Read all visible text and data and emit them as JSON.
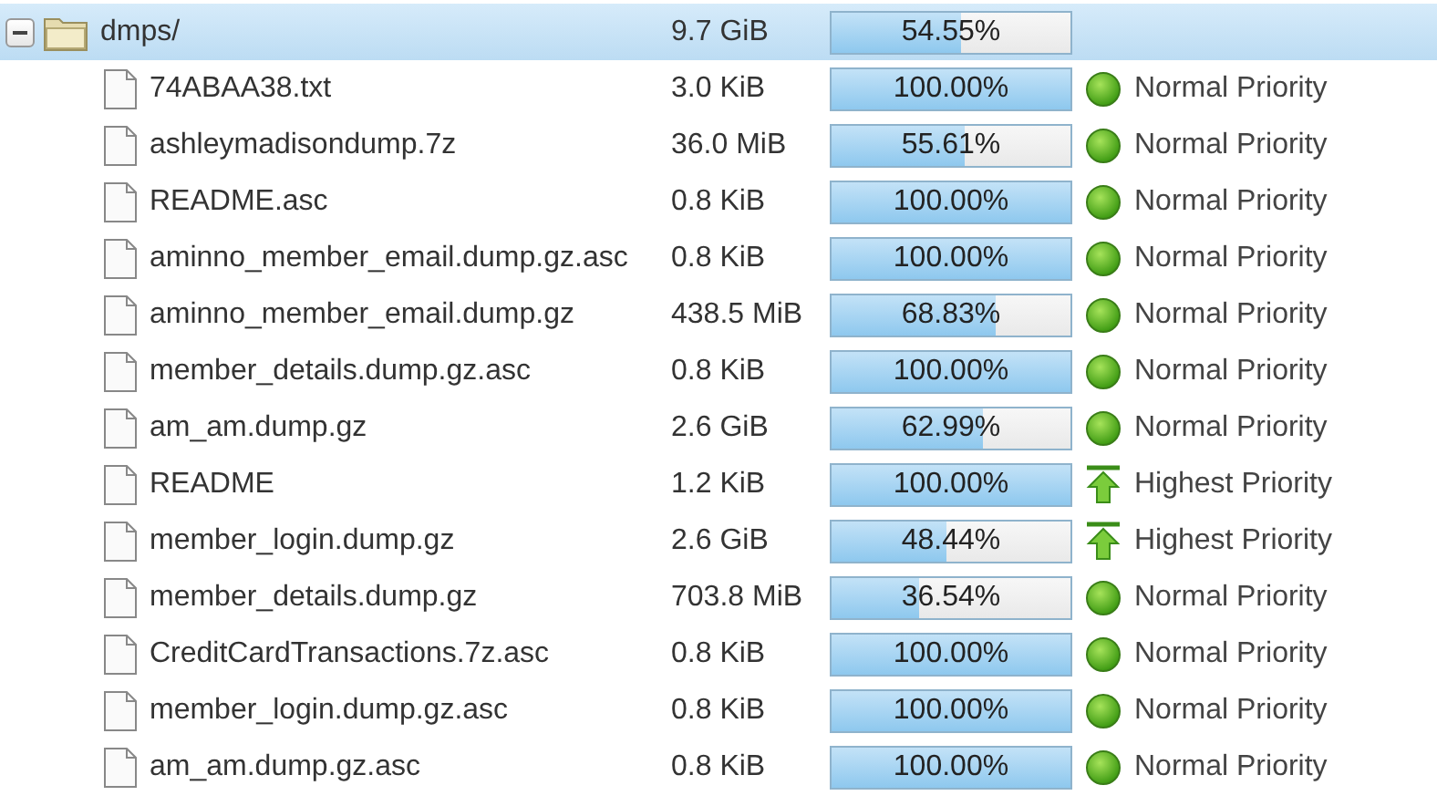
{
  "files": [
    {
      "name": "dmps/",
      "kind": "folder",
      "expanded": true,
      "selected": true,
      "size": "9.7 GiB",
      "level": 0.5455,
      "progress": "54.55%",
      "children": [
        {
          "name": "74ABAA38.txt",
          "kind": "file",
          "size": "3.0 KiB",
          "level": 1,
          "progress": "100.00%",
          "priority": {
            "kind": "normal",
            "label": "Normal Priority"
          }
        },
        {
          "name": "ashleymadisondump.7z",
          "kind": "file",
          "size": "36.0 MiB",
          "level": 0.5561,
          "progress": "55.61%",
          "priority": {
            "kind": "normal",
            "label": "Normal Priority"
          }
        },
        {
          "name": "README.asc",
          "kind": "file",
          "size": "0.8 KiB",
          "level": 1,
          "progress": "100.00%",
          "priority": {
            "kind": "normal",
            "label": "Normal Priority"
          }
        },
        {
          "name": "aminno_member_email.dump.gz.asc",
          "kind": "file",
          "size": "0.8 KiB",
          "level": 1,
          "progress": "100.00%",
          "priority": {
            "kind": "normal",
            "label": "Normal Priority"
          }
        },
        {
          "name": "aminno_member_email.dump.gz",
          "kind": "file",
          "size": "438.5 MiB",
          "level": 0.6883,
          "progress": "68.83%",
          "priority": {
            "kind": "normal",
            "label": "Normal Priority"
          }
        },
        {
          "name": "member_details.dump.gz.asc",
          "kind": "file",
          "size": "0.8 KiB",
          "level": 1,
          "progress": "100.00%",
          "priority": {
            "kind": "normal",
            "label": "Normal Priority"
          }
        },
        {
          "name": "am_am.dump.gz",
          "kind": "file",
          "size": "2.6 GiB",
          "level": 0.6299,
          "progress": "62.99%",
          "priority": {
            "kind": "normal",
            "label": "Normal Priority"
          }
        },
        {
          "name": "README",
          "kind": "file",
          "size": "1.2 KiB",
          "level": 1,
          "progress": "100.00%",
          "priority": {
            "kind": "highest",
            "label": "Highest Priority"
          }
        },
        {
          "name": "member_login.dump.gz",
          "kind": "file",
          "size": "2.6 GiB",
          "level": 0.4844,
          "progress": "48.44%",
          "priority": {
            "kind": "highest",
            "label": "Highest Priority"
          }
        },
        {
          "name": "member_details.dump.gz",
          "kind": "file",
          "size": "703.8 MiB",
          "level": 0.3654,
          "progress": "36.54%",
          "priority": {
            "kind": "normal",
            "label": "Normal Priority"
          }
        },
        {
          "name": "CreditCardTransactions.7z.asc",
          "kind": "file",
          "size": "0.8 KiB",
          "level": 1,
          "progress": "100.00%",
          "priority": {
            "kind": "normal",
            "label": "Normal Priority"
          }
        },
        {
          "name": "member_login.dump.gz.asc",
          "kind": "file",
          "size": "0.8 KiB",
          "level": 1,
          "progress": "100.00%",
          "priority": {
            "kind": "normal",
            "label": "Normal Priority"
          }
        },
        {
          "name": "am_am.dump.gz.asc",
          "kind": "file",
          "size": "0.8 KiB",
          "level": 1,
          "progress": "100.00%",
          "priority": {
            "kind": "normal",
            "label": "Normal Priority"
          }
        }
      ]
    }
  ]
}
